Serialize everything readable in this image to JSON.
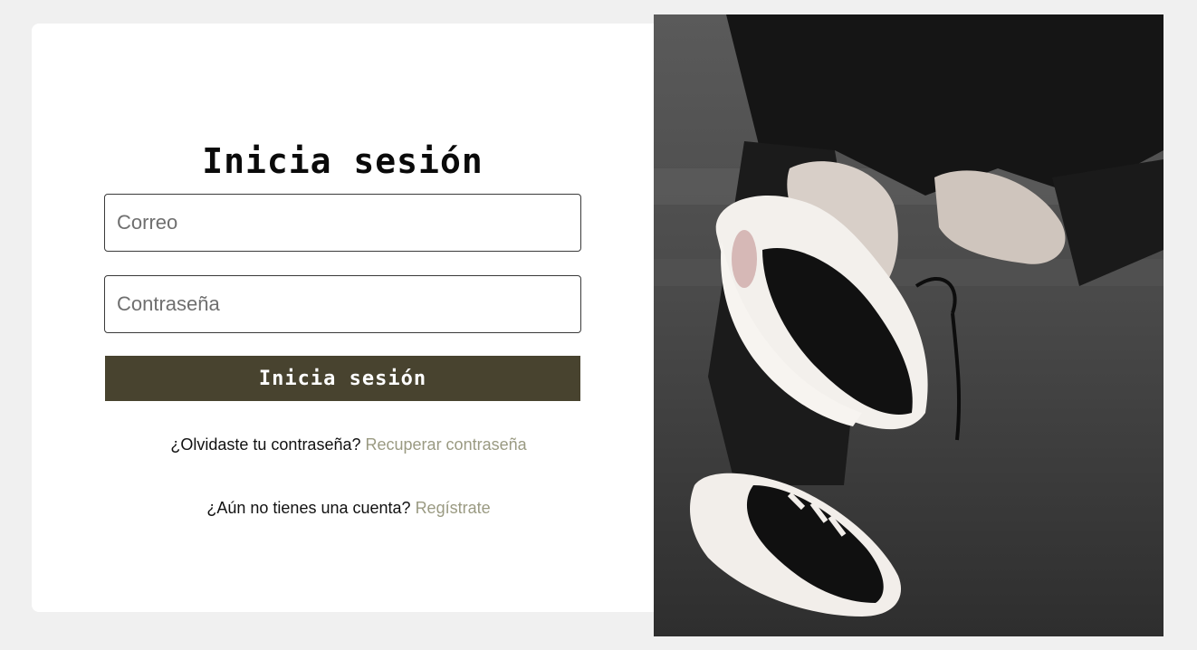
{
  "login": {
    "title": "Inicia sesión",
    "email_placeholder": "Correo",
    "email_value": "",
    "password_placeholder": "Contraseña",
    "password_value": "",
    "submit_label": "Inicia sesión",
    "forgot_prompt": "¿Olvidaste tu contraseña?",
    "forgot_link": "Recuperar contraseña",
    "register_prompt": "¿Aún no tienes una cuenta?",
    "register_link": "Regístrate"
  },
  "colors": {
    "background": "#f0f0f0",
    "card": "#ffffff",
    "button": "#48432f",
    "link": "#9a9a82"
  }
}
